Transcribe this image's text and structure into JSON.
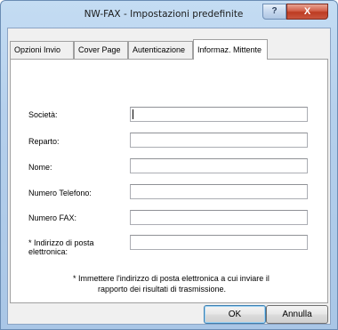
{
  "window": {
    "title": "NW-FAX - Impostazioni predefinite",
    "help_symbol": "?",
    "close_symbol": "X"
  },
  "tabs": [
    {
      "label": "Opzioni Invio"
    },
    {
      "label": "Cover Page"
    },
    {
      "label": "Autenticazione"
    },
    {
      "label": "Informaz. Mittente",
      "active": true
    }
  ],
  "form": {
    "company_label": "Società:",
    "department_label": "Reparto:",
    "name_label": "Nome:",
    "phone_label": "Numero Telefono:",
    "fax_label": "Numero FAX:",
    "email_label_line1": "* Indirizzo di posta",
    "email_label_line2": "elettronica:",
    "company_value": "",
    "department_value": "",
    "name_value": "",
    "phone_value": "",
    "fax_value": "",
    "email_value": ""
  },
  "note": {
    "line1": "* Immettere l'indirizzo di posta elettronica a cui inviare il",
    "line2": "rapporto dei risultati di trasmissione."
  },
  "buttons": {
    "ok": "OK",
    "cancel": "Annulla"
  }
}
